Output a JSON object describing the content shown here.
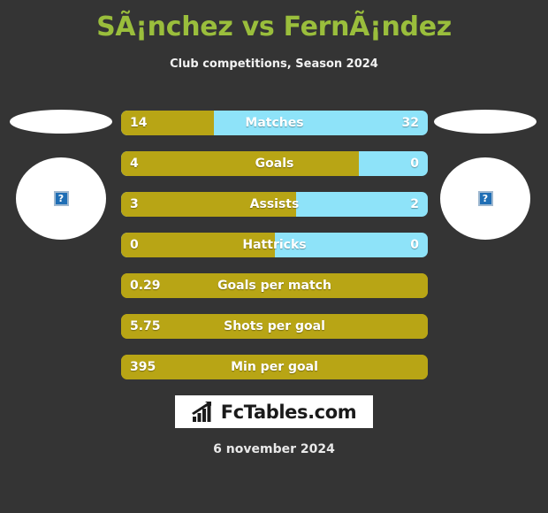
{
  "header": {
    "title": "SÃ¡nchez vs FernÃ¡ndez",
    "subtitle": "Club competitions, Season 2024"
  },
  "colors": {
    "background": "#343434",
    "title_green": "#9ABE3C",
    "left_player_gold": "#B8A515",
    "right_player_blue": "#8EE3F9",
    "text_white": "#FFFFFF"
  },
  "players": {
    "left": {
      "photo_alt": "?",
      "photo_state": "broken-image"
    },
    "right": {
      "photo_alt": "?",
      "photo_state": "broken-image"
    }
  },
  "stats": [
    {
      "label": "Matches",
      "left": "14",
      "right": "32",
      "left_pct": 30.4,
      "has_right": true
    },
    {
      "label": "Goals",
      "left": "4",
      "right": "0",
      "left_pct": 77.5,
      "has_right": true
    },
    {
      "label": "Assists",
      "left": "3",
      "right": "2",
      "left_pct": 57.0,
      "has_right": true
    },
    {
      "label": "Hattricks",
      "left": "0",
      "right": "0",
      "left_pct": 50.0,
      "has_right": true
    },
    {
      "label": "Goals per match",
      "left": "0.29",
      "right": "",
      "left_pct": 100,
      "has_right": false
    },
    {
      "label": "Shots per goal",
      "left": "5.75",
      "right": "",
      "left_pct": 100,
      "has_right": false
    },
    {
      "label": "Min per goal",
      "left": "395",
      "right": "",
      "left_pct": 100,
      "has_right": false
    }
  ],
  "logo": {
    "text": "FcTables.com",
    "icon": "bar-chart-growth-icon"
  },
  "footer": {
    "date": "6 november 2024"
  }
}
